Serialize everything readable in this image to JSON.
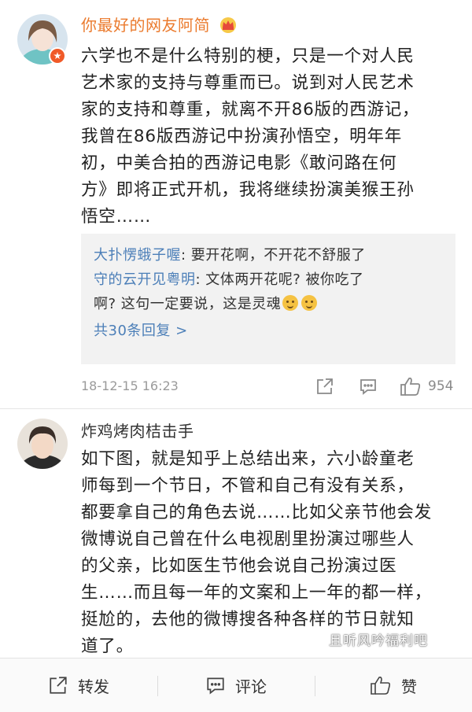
{
  "comment1": {
    "username": "你最好的网友阿简",
    "crown_icon": "crown-icon",
    "badge_icon": "verified-star-icon",
    "lines": [
      "六学也不是什么特别的梗，只是一个对人民",
      "艺术家的支持与尊重而已。说到对人民艺术",
      "家的支持和尊重，就离不开86版的西游记，",
      "我曾在86版西游记中扮演孙悟空，明年年",
      "初，中美合拍的西游记电影《敢问路在何",
      "方》即将正式开机，我将继续扮演美猴王孙",
      "悟空……"
    ],
    "replies": [
      {
        "author": "大扑愣蛾子喔",
        "text": ": 要开花啊，不开花不舒服了"
      },
      {
        "author": "守的云开见粤明",
        "text": ": 文体两开花呢? 被你吃了",
        "text2": "啊? 这句一定要说，这是灵魂"
      }
    ],
    "more_replies": "共30条回复 >",
    "timestamp": "18-12-15 16:23",
    "like_count": "954"
  },
  "comment2": {
    "username": "炸鸡烤肉桔击手",
    "lines": [
      "如下图，就是知乎上总结出来，六小龄童老",
      "师每到一个节日，不管和自己有没有关系，",
      "都要拿自己的角色去说……比如父亲节他会发",
      "微博说自己曾在什么电视剧里扮演过哪些人",
      "的父亲，比如医生节他会说自己扮演过医",
      "生……而且每一年的文案和上一年的都一样，",
      "挺尬的，去他的微博搜各种各样的节日就知",
      "道了。"
    ]
  },
  "watermark": "且听风吟福利吧",
  "bottom_bar": {
    "repost": "转发",
    "comment": "评论",
    "like": "赞"
  },
  "colors": {
    "username_orange": "#eb7b2e",
    "link_blue": "#4c7fb8",
    "reply_bg": "#f2f2f2"
  }
}
